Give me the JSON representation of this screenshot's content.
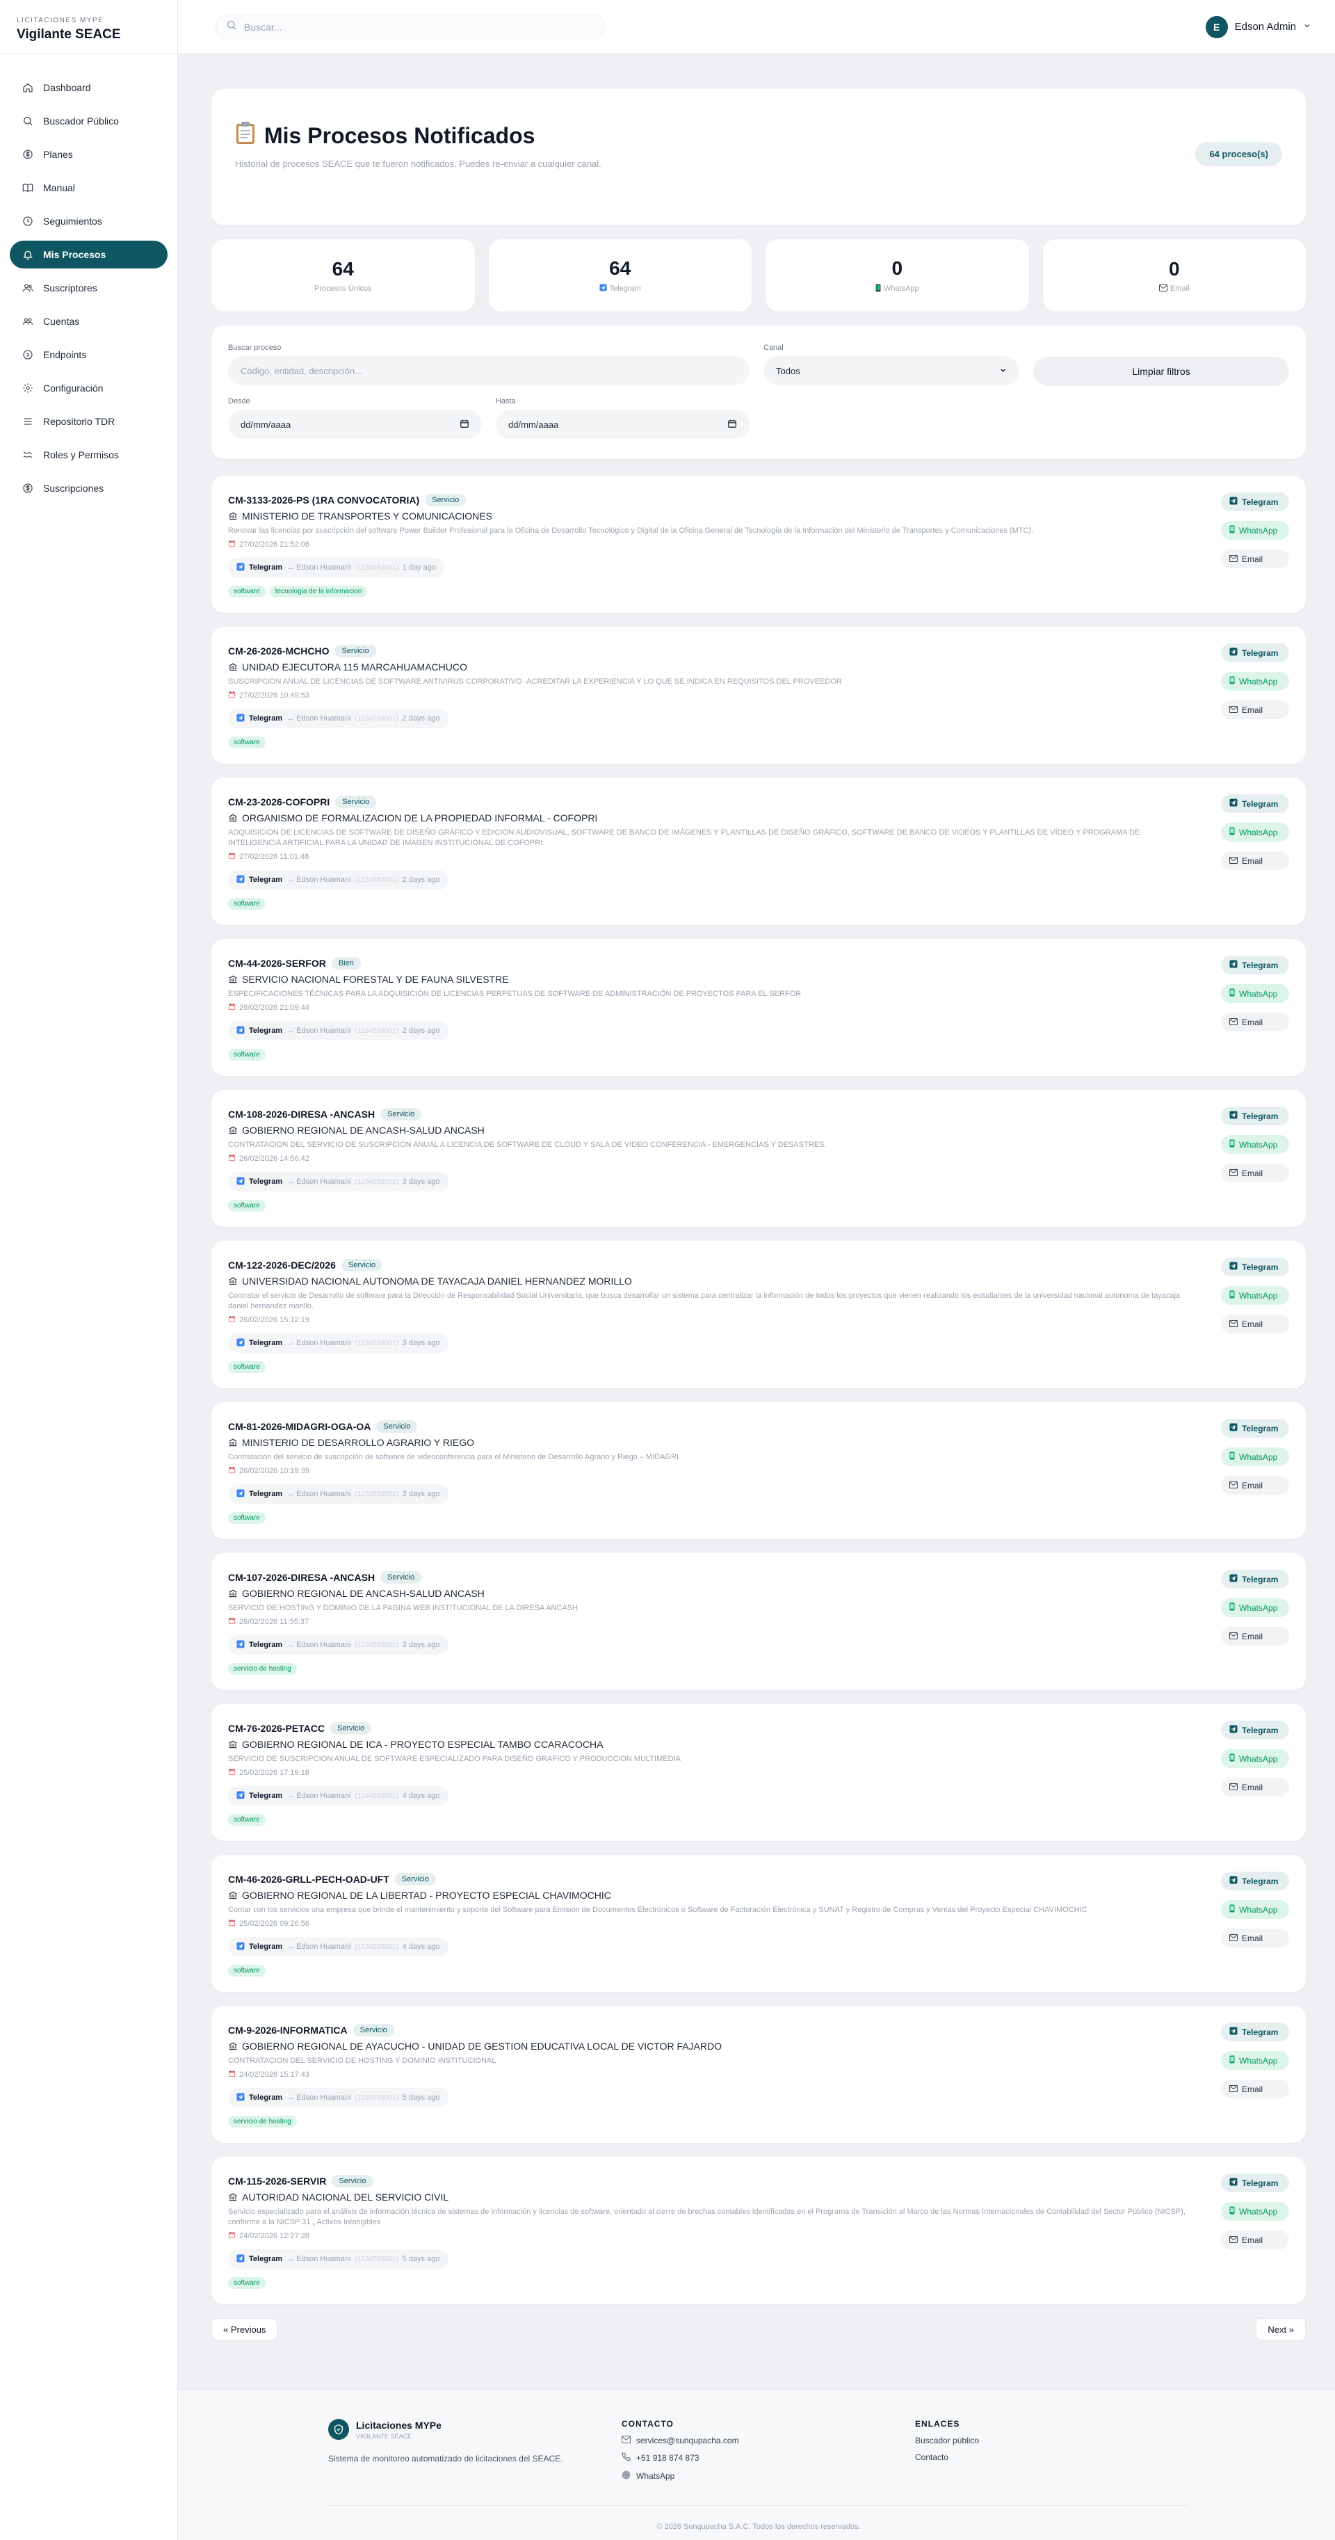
{
  "brand": {
    "sub": "LICITACIONES MYPE",
    "title": "Vigilante SEACE"
  },
  "nav": [
    {
      "label": "Dashboard",
      "icon": "home-icon"
    },
    {
      "label": "Buscador Público",
      "icon": "search-icon"
    },
    {
      "label": "Planes",
      "icon": "dollar-icon"
    },
    {
      "label": "Manual",
      "icon": "book-icon"
    },
    {
      "label": "Seguimientos",
      "icon": "clock-icon"
    },
    {
      "label": "Mis Procesos",
      "icon": "bell-icon",
      "active": true
    },
    {
      "label": "Suscriptores",
      "icon": "users-icon"
    },
    {
      "label": "Cuentas",
      "icon": "accounts-icon"
    },
    {
      "label": "Endpoints",
      "icon": "endpoint-icon"
    },
    {
      "label": "Configuración",
      "icon": "gear-icon"
    },
    {
      "label": "Repositorio TDR",
      "icon": "repository-icon"
    },
    {
      "label": "Roles y Permisos",
      "icon": "roles-icon"
    },
    {
      "label": "Suscripciones",
      "icon": "dollar-icon"
    }
  ],
  "topbar": {
    "search_placeholder": "Buscar...",
    "user_initial": "E",
    "user_name": "Edson Admin"
  },
  "header": {
    "title": "Mis Procesos Notificados",
    "subtitle": "Historial de procesos SEACE que te fueron notificados. Puedes re-enviar a cualquier canal.",
    "count": "64 proceso(s)"
  },
  "stats": [
    {
      "value": "64",
      "label": "Procesos Únicos"
    },
    {
      "value": "64",
      "label": "Telegram"
    },
    {
      "value": "0",
      "label": "WhatsApp"
    },
    {
      "value": "0",
      "label": "Email"
    }
  ],
  "filters": {
    "search_label": "Buscar proceso",
    "search_placeholder": "Código, entidad, descripción...",
    "canal_label": "Canal",
    "canal_value": "Todos",
    "clear_label": "Limpiar filtros",
    "desde_label": "Desde",
    "hasta_label": "Hasta",
    "date_placeholder": "dd/mm/aaaa"
  },
  "actions": {
    "telegram": "Telegram",
    "whatsapp": "WhatsApp",
    "email": "Email"
  },
  "notif_to": "→ Edson Huamani",
  "notif_id": "(1234560001)",
  "procesos": [
    {
      "code": "CM-3133-2026-PS (1RA CONVOCATORIA)",
      "type": "Servicio",
      "entity": "MINISTERIO DE TRANSPORTES Y COMUNICACIONES",
      "desc": "Renovar las licencias por suscripción del software Power Builder Profesional para la Oficina de Desarrollo Tecnológico y Digital de la Oficina General de Tecnología de la Información del Ministerio de Transportes y Comunicaciones (MTC).",
      "date": "27/02/2026 21:52:06",
      "channel": "Telegram",
      "ago": "1 day ago",
      "tags": [
        "software",
        "tecnologia de la informacion"
      ]
    },
    {
      "code": "CM-26-2026-MCHCHO",
      "type": "Servicio",
      "entity": "UNIDAD EJECUTORA 115 MARCAHUAMACHUCO",
      "desc": "SUSCRIPCION ANUAL DE LICENCIAS DE SOFTWARE ANTIVIRUS CORPORATIVO -ACREDITAR LA EXPERIENCIA Y LO QUE SE INDICA EN REQUISITOS DEL PROVEEDOR",
      "date": "27/02/2026 10:49:53",
      "channel": "Telegram",
      "ago": "2 days ago",
      "tags": [
        "software"
      ]
    },
    {
      "code": "CM-23-2026-COFOPRI",
      "type": "Servicio",
      "entity": "ORGANISMO DE FORMALIZACION DE LA PROPIEDAD INFORMAL - COFOPRI",
      "desc": "ADQUISICIÓN DE LICENCIAS DE SOFTWARE DE DISEÑO GRÁFICO Y EDICIÓN AUDIOVISUAL, SOFTWARE DE BANCO DE IMÁGENES Y PLANTILLAS DE DISEÑO GRÁFICO, SOFTWARE DE BANCO DE VIDEOS Y PLANTILLAS DE VÍDEO Y PROGRAMA DE INTELIGENCIA ARTIFICIAL PARA LA UNIDAD DE IMAGEN INSTITUCIONAL DE COFOPRI",
      "date": "27/02/2026 11:01:48",
      "channel": "Telegram",
      "ago": "2 days ago",
      "tags": [
        "software"
      ]
    },
    {
      "code": "CM-44-2026-SERFOR",
      "type": "Bien",
      "entity": "SERVICIO NACIONAL FORESTAL Y DE FAUNA SILVESTRE",
      "desc": "ESPECIFICACIONES TÉCNICAS PARA LA ADQUISICIÓN DE LICENCIAS PERPETUAS DE SOFTWARE DE ADMINISTRACIÓN DE PROYECTOS PARA EL SERFOR",
      "date": "26/02/2026 21:09:44",
      "channel": "Telegram",
      "ago": "2 days ago",
      "tags": [
        "software"
      ]
    },
    {
      "code": "CM-108-2026-DIRESA -ANCASH",
      "type": "Servicio",
      "entity": "GOBIERNO REGIONAL DE ANCASH-SALUD ANCASH",
      "desc": "CONTRATACION DEL SERVICIO DE SUSCRIPCION ANUAL A LICENCIA DE SOFTWARE DE CLOUD Y SALA DE VIDEO CONFERENCIA - EMERGENCIAS Y DESASTRES.",
      "date": "26/02/2026 14:56:42",
      "channel": "Telegram",
      "ago": "3 days ago",
      "tags": [
        "software"
      ]
    },
    {
      "code": "CM-122-2026-DEC/2026",
      "type": "Servicio",
      "entity": "UNIVERSIDAD NACIONAL AUTONOMA DE TAYACAJA DANIEL HERNANDEZ MORILLO",
      "desc": "Contratar el servicio de Desarrollo de software para la Dirección de Responsabilidad Social Universitaria, que busca desarrollar un sistema para centralizar la información de todos los proyectos que vienen realizando los estudiantes de la universidad nacional autonoma de tayacaja daniel hernandez morillo.",
      "date": "26/02/2026 15:12:19",
      "channel": "Telegram",
      "ago": "3 days ago",
      "tags": [
        "software"
      ]
    },
    {
      "code": "CM-81-2026-MIDAGRI-OGA-OA",
      "type": "Servicio",
      "entity": "MINISTERIO DE DESARROLLO AGRARIO Y RIEGO",
      "desc": "Contratación del servicio de suscripción de software de videoconferencia para el Ministerio de Desarrollo Agrario y Riego – MIDAGRI",
      "date": "26/02/2026 10:19:39",
      "channel": "Telegram",
      "ago": "3 days ago",
      "tags": [
        "software"
      ]
    },
    {
      "code": "CM-107-2026-DIRESA -ANCASH",
      "type": "Servicio",
      "entity": "GOBIERNO REGIONAL DE ANCASH-SALUD ANCASH",
      "desc": "SERVICIO DE HOSTING Y DOMINIO DE LA PAGINA WEB INSTITUCIONAL DE LA DIRESA ANCASH",
      "date": "26/02/2026 11:55:37",
      "channel": "Telegram",
      "ago": "3 days ago",
      "tags": [
        "servicio de hosting"
      ]
    },
    {
      "code": "CM-76-2026-PETACC",
      "type": "Servicio",
      "entity": "GOBIERNO REGIONAL DE ICA - PROYECTO ESPECIAL TAMBO CCARACOCHA",
      "desc": "SERVICIO DE SUSCRIPCION ANUAL DE SOFTWARE ESPECIALIZADO PARA DISEÑO GRAFICO Y PRODUCCION MULTIMEDIA",
      "date": "25/02/2026 17:19:18",
      "channel": "Telegram",
      "ago": "4 days ago",
      "tags": [
        "software"
      ]
    },
    {
      "code": "CM-46-2026-GRLL-PECH-OAD-UFT",
      "type": "Servicio",
      "entity": "GOBIERNO REGIONAL DE LA LIBERTAD - PROYECTO ESPECIAL CHAVIMOCHIC",
      "desc": "Contar con los servicios una empresa que brinde el mantenimiento y soporte del Software para Emisión de Documentos Electrónicos o Software de Facturación Electrónica y SUNAT y Registro de Compras y Ventas del Proyecto Especial CHAVIMOCHIC",
      "date": "25/02/2026 09:26:56",
      "channel": "Telegram",
      "ago": "4 days ago",
      "tags": [
        "software"
      ]
    },
    {
      "code": "CM-9-2026-INFORMATICA",
      "type": "Servicio",
      "entity": "GOBIERNO REGIONAL DE AYACUCHO - UNIDAD DE GESTION EDUCATIVA LOCAL DE VICTOR FAJARDO",
      "desc": "CONTRATACION DEL SERVICIO DE HOSTING Y DOMINIO INSTITUCIONAL",
      "date": "24/02/2026 15:17:43",
      "channel": "Telegram",
      "ago": "5 days ago",
      "tags": [
        "servicio de hosting"
      ]
    },
    {
      "code": "CM-115-2026-SERVIR",
      "type": "Servicio",
      "entity": "AUTORIDAD NACIONAL DEL SERVICIO CIVIL",
      "desc": "Servicio especializado para el análisis de información técnica de sistemas de información y licencias de software, orientado al cierre de brechas contables identificadas en el Programa de Transición al Marco de las Normas Internacionales de Contabilidad del Sector Público (NICSP), conforme a la NICSP 31 „ Activos Intangibles",
      "date": "24/02/2026 12:27:28",
      "channel": "Telegram",
      "ago": "5 days ago",
      "tags": [
        "software"
      ]
    }
  ],
  "pager": {
    "prev": "« Previous",
    "next": "Next »"
  },
  "footer": {
    "brand": "Licitaciones MYPe",
    "brand_sub": "VIGILANTE SEACE",
    "desc": "Sistema de monitoreo automatizado de licitaciones del SEACE.",
    "contact_head": "CONTACTO",
    "email": "services@sunqupacha.com",
    "phone": "+51 918 874 873",
    "whatsapp": "WhatsApp",
    "links_head": "ENLACES",
    "link1": "Buscador público",
    "link2": "Contacto",
    "copyright": "© 2026 Sunqupacha S.A.C. Todos los derechos reservados."
  },
  "colors": {
    "primary": "#0e5662",
    "success": "#059669",
    "background": "#eef0f3"
  }
}
